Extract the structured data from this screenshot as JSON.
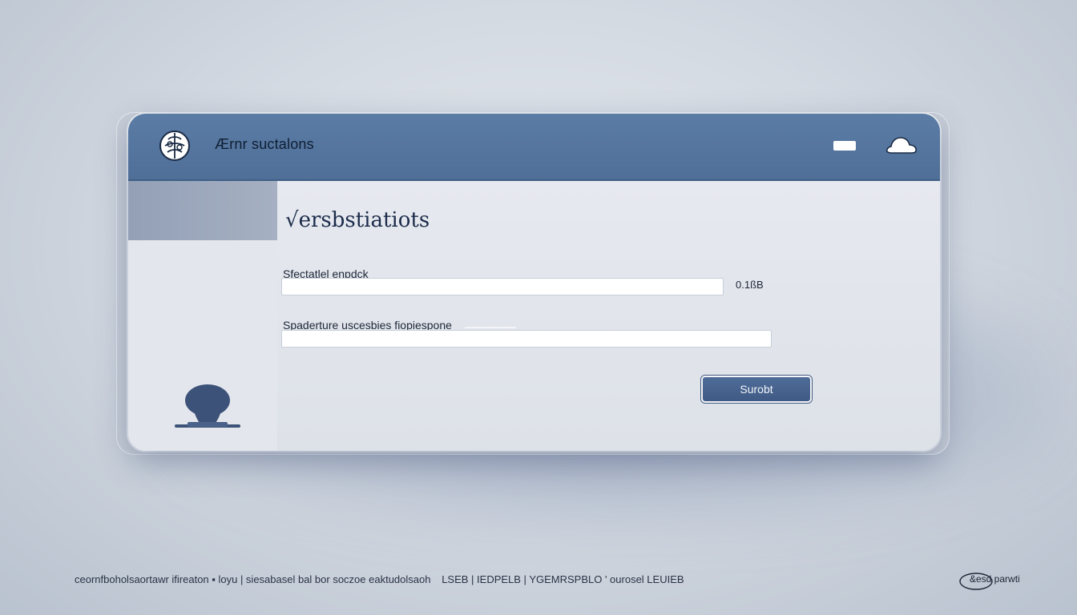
{
  "window": {
    "title": "Ærnr suctalons",
    "logo_icon": "brain-icon",
    "minimize_icon": "minimize-icon",
    "cloud_icon": "cloud-icon"
  },
  "content": {
    "page_title": "√ersbstiatiots",
    "field1": {
      "label": "Sfectatlel enpdck",
      "value": "",
      "suffix": "0.1ßB"
    },
    "field2": {
      "label": "Spaderture uscesbies fiopiespone",
      "value": ""
    },
    "submit_label": "Surobt"
  },
  "avatar_icon": "user-avatar-icon",
  "footer": {
    "text": "ceornfboholsaortawr ifireaton ▪ loyu | siesabasel bal bor soczoe eaktudolsaoh   LSEB | IEDPELB | YGEMRSPBLO ' ourosel LEUIEB",
    "logo_label": "&esd parwti"
  },
  "colors": {
    "titlebar": "#5676a0",
    "accent": "#3f5a84",
    "background": "#d4dae2"
  }
}
